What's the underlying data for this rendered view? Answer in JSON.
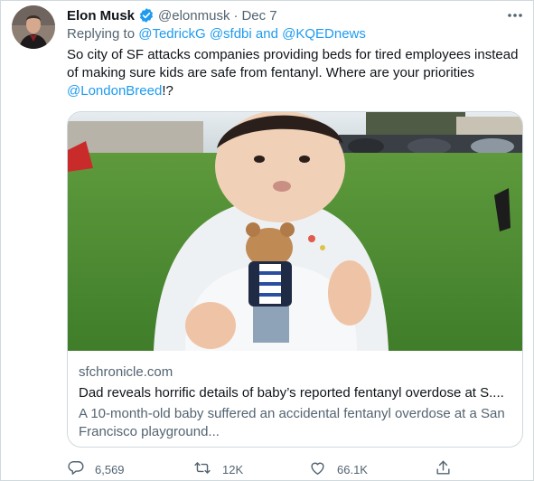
{
  "tweet": {
    "author_name": "Elon Musk",
    "author_handle": "@elonmusk",
    "separator": "·",
    "date": "Dec 7",
    "reply_prefix": "Replying to",
    "reply_handle_1": "@TedrickG",
    "reply_handle_2": "@sfdbi",
    "reply_and": "and",
    "reply_handle_3": "@KQEDnews",
    "text_line_1": "So city of SF attacks companies providing beds for tired employees instead",
    "text_line_2": "of making sure kids are safe from fentanyl. Where are your priorities",
    "text_mention": "@LondonBreed",
    "text_tail": "!?"
  },
  "card": {
    "domain": "sfchronicle.com",
    "title": "Dad reveals horrific details of baby’s reported fentanyl overdose at S....",
    "description": "A 10-month-old baby suffered an accidental fentanyl overdose at a San Francisco playground..."
  },
  "actions": {
    "replies": "6,569",
    "retweets": "12K",
    "likes": "66.1K"
  },
  "icons": {
    "verified": "verified-badge-icon",
    "more": "more-options-icon",
    "reply": "reply-icon",
    "retweet": "retweet-icon",
    "like": "like-icon",
    "share": "share-icon"
  },
  "colors": {
    "link": "#1d9bf0",
    "secondary_text": "#536471",
    "primary_text": "#0f1419",
    "border": "#cfd9de"
  }
}
